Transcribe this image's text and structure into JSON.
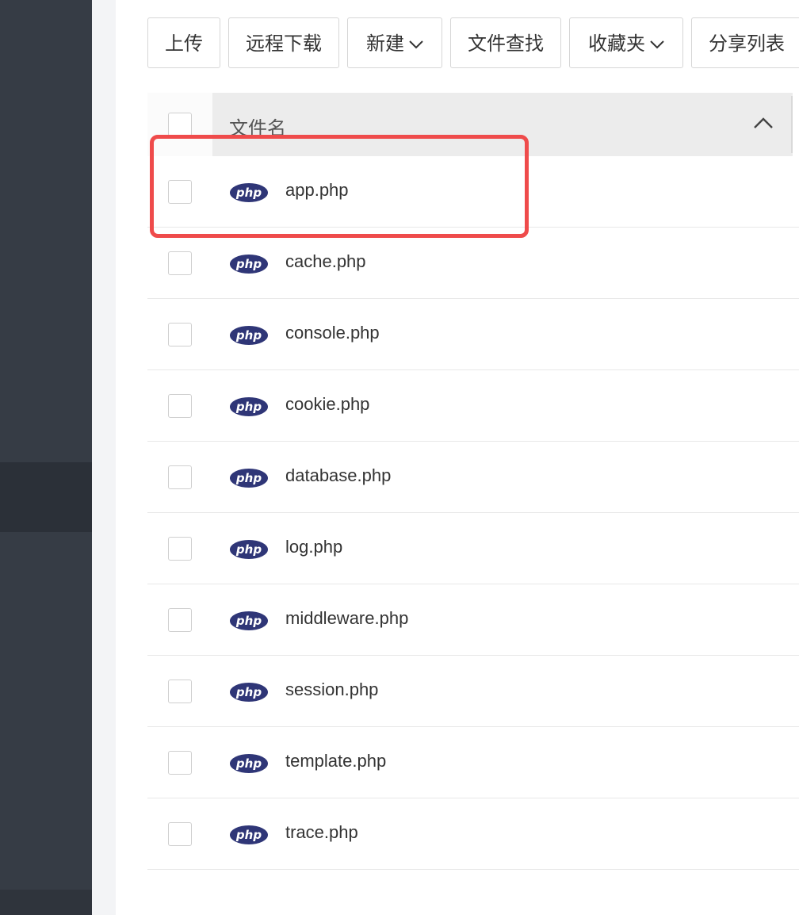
{
  "toolbar": {
    "upload_label": "上传",
    "remote_download_label": "远程下载",
    "new_label": "新建",
    "file_search_label": "文件查找",
    "favorites_label": "收藏夹",
    "share_list_label": "分享列表"
  },
  "table": {
    "header_filename": "文件名",
    "sort_direction": "ascending",
    "rows": [
      {
        "name": "app.php",
        "icon": "php-file-icon",
        "highlighted": true
      },
      {
        "name": "cache.php",
        "icon": "php-file-icon"
      },
      {
        "name": "console.php",
        "icon": "php-file-icon"
      },
      {
        "name": "cookie.php",
        "icon": "php-file-icon"
      },
      {
        "name": "database.php",
        "icon": "php-file-icon"
      },
      {
        "name": "log.php",
        "icon": "php-file-icon"
      },
      {
        "name": "middleware.php",
        "icon": "php-file-icon"
      },
      {
        "name": "session.php",
        "icon": "php-file-icon"
      },
      {
        "name": "template.php",
        "icon": "php-file-icon"
      },
      {
        "name": "trace.php",
        "icon": "php-file-icon"
      }
    ]
  },
  "php_icon_text": "php",
  "colors": {
    "sidebar": "#363c45",
    "highlight": "#ef4b4b",
    "php_icon": "#2f3677"
  }
}
